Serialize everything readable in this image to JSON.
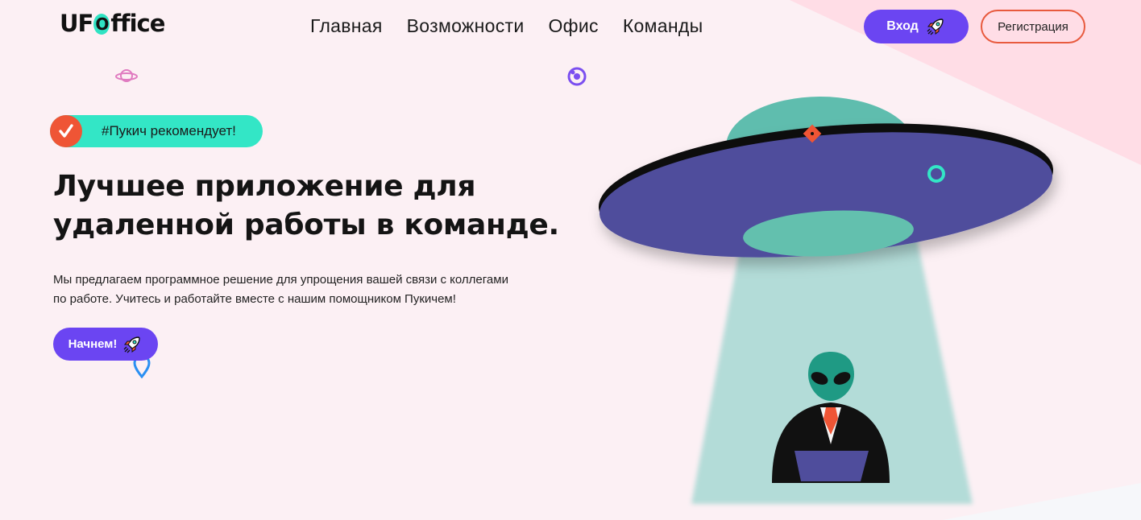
{
  "header": {
    "logo": {
      "prefix": "UF",
      "o": "O",
      "suffix": "ffice"
    },
    "nav": [
      {
        "label": "Главная"
      },
      {
        "label": "Возможности"
      },
      {
        "label": "Офис"
      },
      {
        "label": "Команды"
      }
    ],
    "login_label": "Вход",
    "register_label": "Регистрация"
  },
  "hero": {
    "badge_text": "#Пукич рекомендует!",
    "headline": [
      "Лучшее приложение для",
      "удаленной работы в команде."
    ],
    "description": [
      "Мы предлагаем программное решение для упрощения вашей связи с коллегами",
      "по работе. Учитесь и работайте вместе с нашим помощником Пукичем!"
    ],
    "cta_label": "Начнем!"
  },
  "icons": {
    "badge": "check-icon",
    "buttons": "rocket-icon",
    "decorations": [
      "planet-icon",
      "orbit-icon",
      "map-pin-icon"
    ],
    "illustration": "ufo-alien-illustration"
  },
  "colors": {
    "accent_purple": "#6b45f2",
    "accent_teal": "#33e6c6",
    "accent_orange": "#ef5535",
    "background": "#fcf0f4"
  }
}
